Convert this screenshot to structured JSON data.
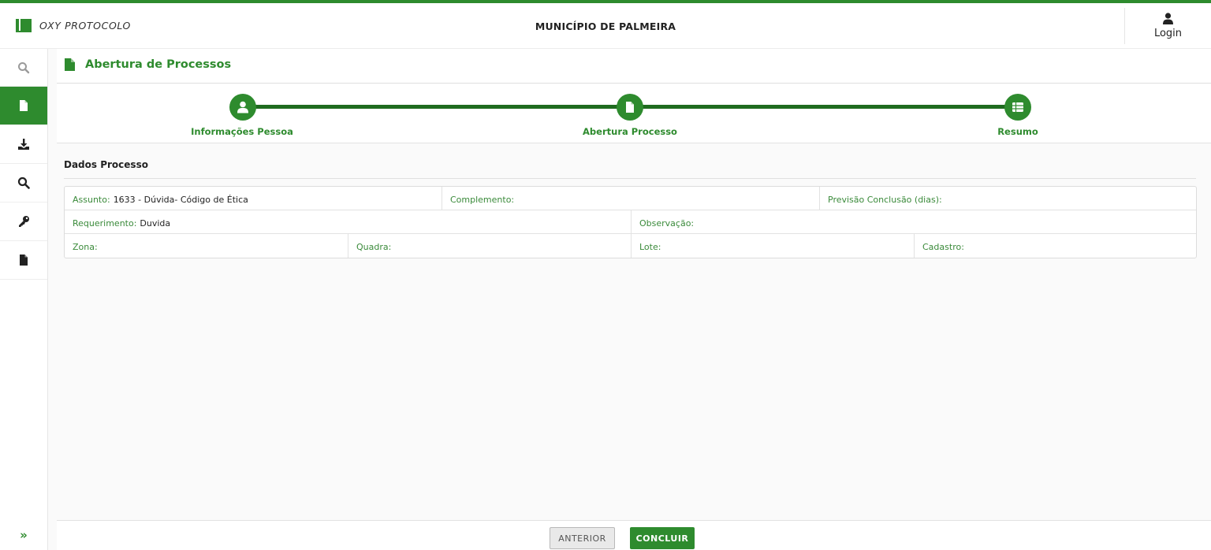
{
  "header": {
    "brand": "OXY PROTOCOLO",
    "title": "MUNICÍPIO DE PALMEIRA",
    "login_label": "Login"
  },
  "sidebar": {
    "items": [
      {
        "icon": "search-icon"
      },
      {
        "icon": "file-icon",
        "active": true
      },
      {
        "icon": "download-icon"
      },
      {
        "icon": "search-icon"
      },
      {
        "icon": "key-icon"
      },
      {
        "icon": "file-icon"
      }
    ],
    "expand_label": "»"
  },
  "page": {
    "title": "Abertura de Processos"
  },
  "stepper": {
    "steps": [
      {
        "label": "Informações Pessoa",
        "icon": "user-icon"
      },
      {
        "label": "Abertura Processo",
        "icon": "file-icon"
      },
      {
        "label": "Resumo",
        "icon": "table-icon"
      }
    ]
  },
  "dados": {
    "section_title": "Dados Processo",
    "assunto_label": "Assunto:",
    "assunto_value": "1633 - Dúvida- Código de Ética",
    "complemento_label": "Complemento:",
    "previsao_label": "Previsão Conclusão (dias):",
    "requerimento_label": "Requerimento:",
    "requerimento_value": "Duvida",
    "observacao_label": "Observação:",
    "zona_label": "Zona:",
    "quadra_label": "Quadra:",
    "lote_label": "Lote:",
    "cadastro_label": "Cadastro:"
  },
  "footer": {
    "prev_label": "ANTERIOR",
    "next_label": "CONCLUIR"
  },
  "colors": {
    "accent": "#2e8b2e",
    "stepper_line": "#1f6b1f"
  }
}
